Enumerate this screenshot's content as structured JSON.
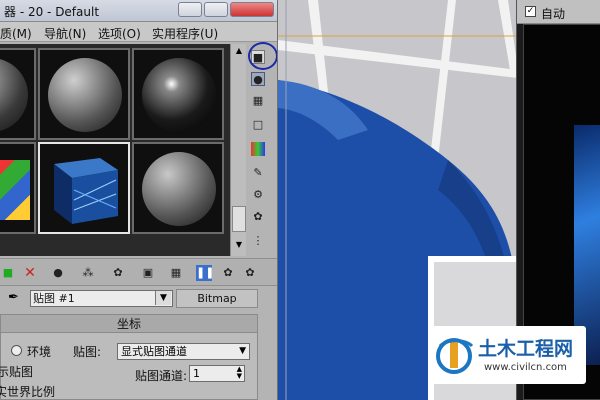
{
  "window": {
    "title": "器 - 20 - Default"
  },
  "menu": [
    {
      "label": "质(M)"
    },
    {
      "label": "导航(N)"
    },
    {
      "label": "选项(O)"
    },
    {
      "label": "实用程序(U)"
    }
  ],
  "slots": [
    {
      "name": "slot-1",
      "kind": "sphere-dark"
    },
    {
      "name": "slot-2",
      "kind": "sphere-grey"
    },
    {
      "name": "slot-3",
      "kind": "sphere-gloss"
    },
    {
      "name": "slot-4",
      "kind": "box-colored"
    },
    {
      "name": "slot-5",
      "kind": "box-bitmap",
      "selected": true
    },
    {
      "name": "slot-6",
      "kind": "sphere-grey"
    }
  ],
  "material": {
    "name": "贴图 #1",
    "type_button": "Bitmap"
  },
  "rollout": {
    "title": "坐标",
    "environ_label": "环境",
    "map_label": "贴图:",
    "map_value": "显式贴图通道",
    "show_map_label": "在视口中显示贴图",
    "show_map_partial": "显示贴图",
    "realworld_label": "实世界比例",
    "channel_label": "贴图通道:",
    "channel_value": "1"
  },
  "right_panel": {
    "auto_label": "自动"
  },
  "watermark": {
    "text": "土木工程网",
    "url": "www.civilcn.com"
  },
  "colors": {
    "accent_blue": "#1e4fa8",
    "highlight_circle": "#1b2aa8"
  }
}
